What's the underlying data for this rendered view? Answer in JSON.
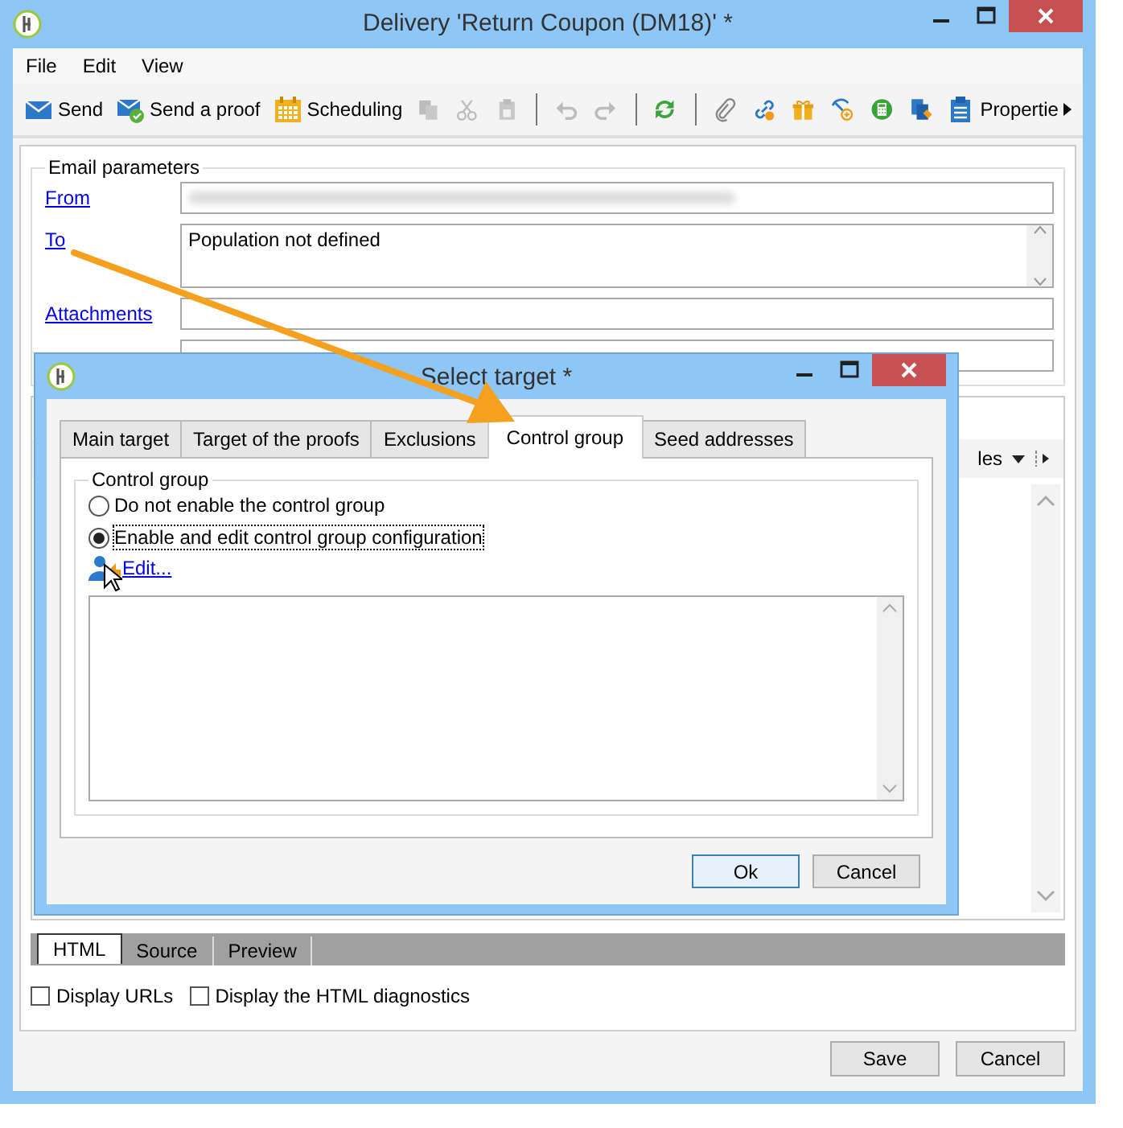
{
  "window": {
    "title": "Delivery 'Return Coupon (DM18)' *"
  },
  "menu": [
    "File",
    "Edit",
    "View"
  ],
  "toolbar": [
    {
      "kind": "button",
      "label": "Send",
      "disabled": false
    },
    {
      "kind": "button",
      "label": "Send a proof",
      "disabled": false
    },
    {
      "kind": "button",
      "label": "Scheduling",
      "disabled": false
    },
    {
      "kind": "icon",
      "disabled": true
    },
    {
      "kind": "icon",
      "disabled": true
    },
    {
      "kind": "icon",
      "disabled": true
    },
    {
      "kind": "separator"
    },
    {
      "kind": "icon",
      "disabled": true
    },
    {
      "kind": "icon",
      "disabled": true
    },
    {
      "kind": "separator"
    },
    {
      "kind": "icon",
      "disabled": false
    },
    {
      "kind": "separator"
    },
    {
      "kind": "icon",
      "disabled": false
    },
    {
      "kind": "icon",
      "disabled": false
    },
    {
      "kind": "icon",
      "disabled": false
    },
    {
      "kind": "icon",
      "disabled": false
    },
    {
      "kind": "icon",
      "disabled": false
    },
    {
      "kind": "icon",
      "disabled": false
    },
    {
      "kind": "button",
      "label": "Propertie",
      "disabled": false
    }
  ],
  "email_parameters": {
    "title": "Email parameters",
    "fields": [
      {
        "label": "From",
        "kind": "blurred"
      },
      {
        "label": "To",
        "kind": "multiline",
        "value": "Population not defined"
      },
      {
        "label": "Attachments",
        "kind": "single"
      }
    ]
  },
  "editor": {
    "dropdown_text": "les",
    "tabs": [
      {
        "label": "HTML",
        "selected": true
      },
      {
        "label": "Source",
        "selected": false
      },
      {
        "label": "Preview",
        "selected": false
      }
    ],
    "options": [
      {
        "label": "Display URLs",
        "checked": false
      },
      {
        "label": "Display the HTML diagnostics",
        "checked": false
      }
    ]
  },
  "buttons": [
    "Save",
    "Cancel"
  ],
  "dialog": {
    "title": "Select target *",
    "tabs": [
      {
        "label": "Main target",
        "selected": false
      },
      {
        "label": "Target of the proofs",
        "selected": false
      },
      {
        "label": "Exclusions",
        "selected": false
      },
      {
        "label": "Control group",
        "selected": true
      },
      {
        "label": "Seed addresses",
        "selected": false
      }
    ],
    "group_title": "Control group",
    "radios": [
      {
        "label": "Do not enable the control group",
        "selected": false,
        "focused": false
      },
      {
        "label": "Enable and edit control group configuration",
        "selected": true,
        "focused": true
      }
    ],
    "edit_link": "Edit...",
    "buttons": [
      {
        "label": "Ok",
        "default": true
      },
      {
        "label": "Cancel",
        "default": false
      }
    ]
  }
}
